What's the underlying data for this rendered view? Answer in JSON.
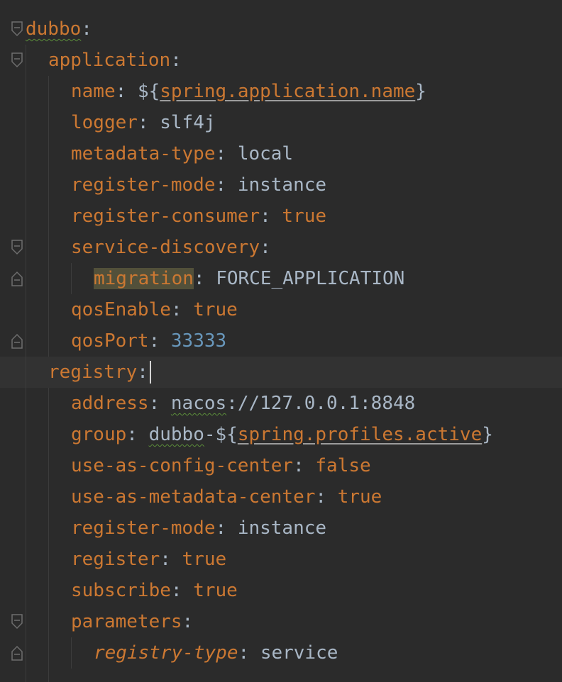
{
  "editor": {
    "colors": {
      "background": "#2b2b2b",
      "key": "#cc7832",
      "value": "#a9b7c6",
      "number": "#6897bb",
      "current_line": "#323232",
      "highlight": "#52503a"
    },
    "lines": [
      {
        "key": "dubbo",
        "sep": ":"
      },
      {
        "key": "application",
        "sep": ":"
      },
      {
        "key": "name",
        "sep": ": ",
        "v1": "${",
        "ref": "spring.application.name",
        "v2": "}"
      },
      {
        "key": "logger",
        "sep": ": ",
        "value": "slf4j"
      },
      {
        "key": "metadata-type",
        "sep": ": ",
        "value": "local"
      },
      {
        "key": "register-mode",
        "sep": ": ",
        "value": "instance"
      },
      {
        "key": "register-consumer",
        "sep": ": ",
        "value": "true"
      },
      {
        "key": "service-discovery",
        "sep": ":"
      },
      {
        "key": "migration",
        "sep": ": ",
        "value": "FORCE_APPLICATION"
      },
      {
        "key": "qosEnable",
        "sep": ": ",
        "value": "true"
      },
      {
        "key": "qosPort",
        "sep": ": ",
        "value": "33333"
      },
      {
        "key": "registry",
        "sep": ":"
      },
      {
        "key": "address",
        "sep": ": ",
        "v1": "nacos",
        "value": "://127.0.0.1:8848"
      },
      {
        "key": "group",
        "sep": ": ",
        "v1": "dubbo",
        "v2": "-${",
        "ref": "spring.profiles.active",
        "v3": "}"
      },
      {
        "key": "use-as-config-center",
        "sep": ": ",
        "value": "false"
      },
      {
        "key": "use-as-metadata-center",
        "sep": ": ",
        "value": "true"
      },
      {
        "key": "register-mode",
        "sep": ": ",
        "value": "instance"
      },
      {
        "key": "register",
        "sep": ": ",
        "value": "true"
      },
      {
        "key": "subscribe",
        "sep": ": ",
        "value": "true"
      },
      {
        "key": "parameters",
        "sep": ":"
      },
      {
        "key": "registry-type",
        "sep": ": ",
        "value": "service"
      }
    ]
  }
}
